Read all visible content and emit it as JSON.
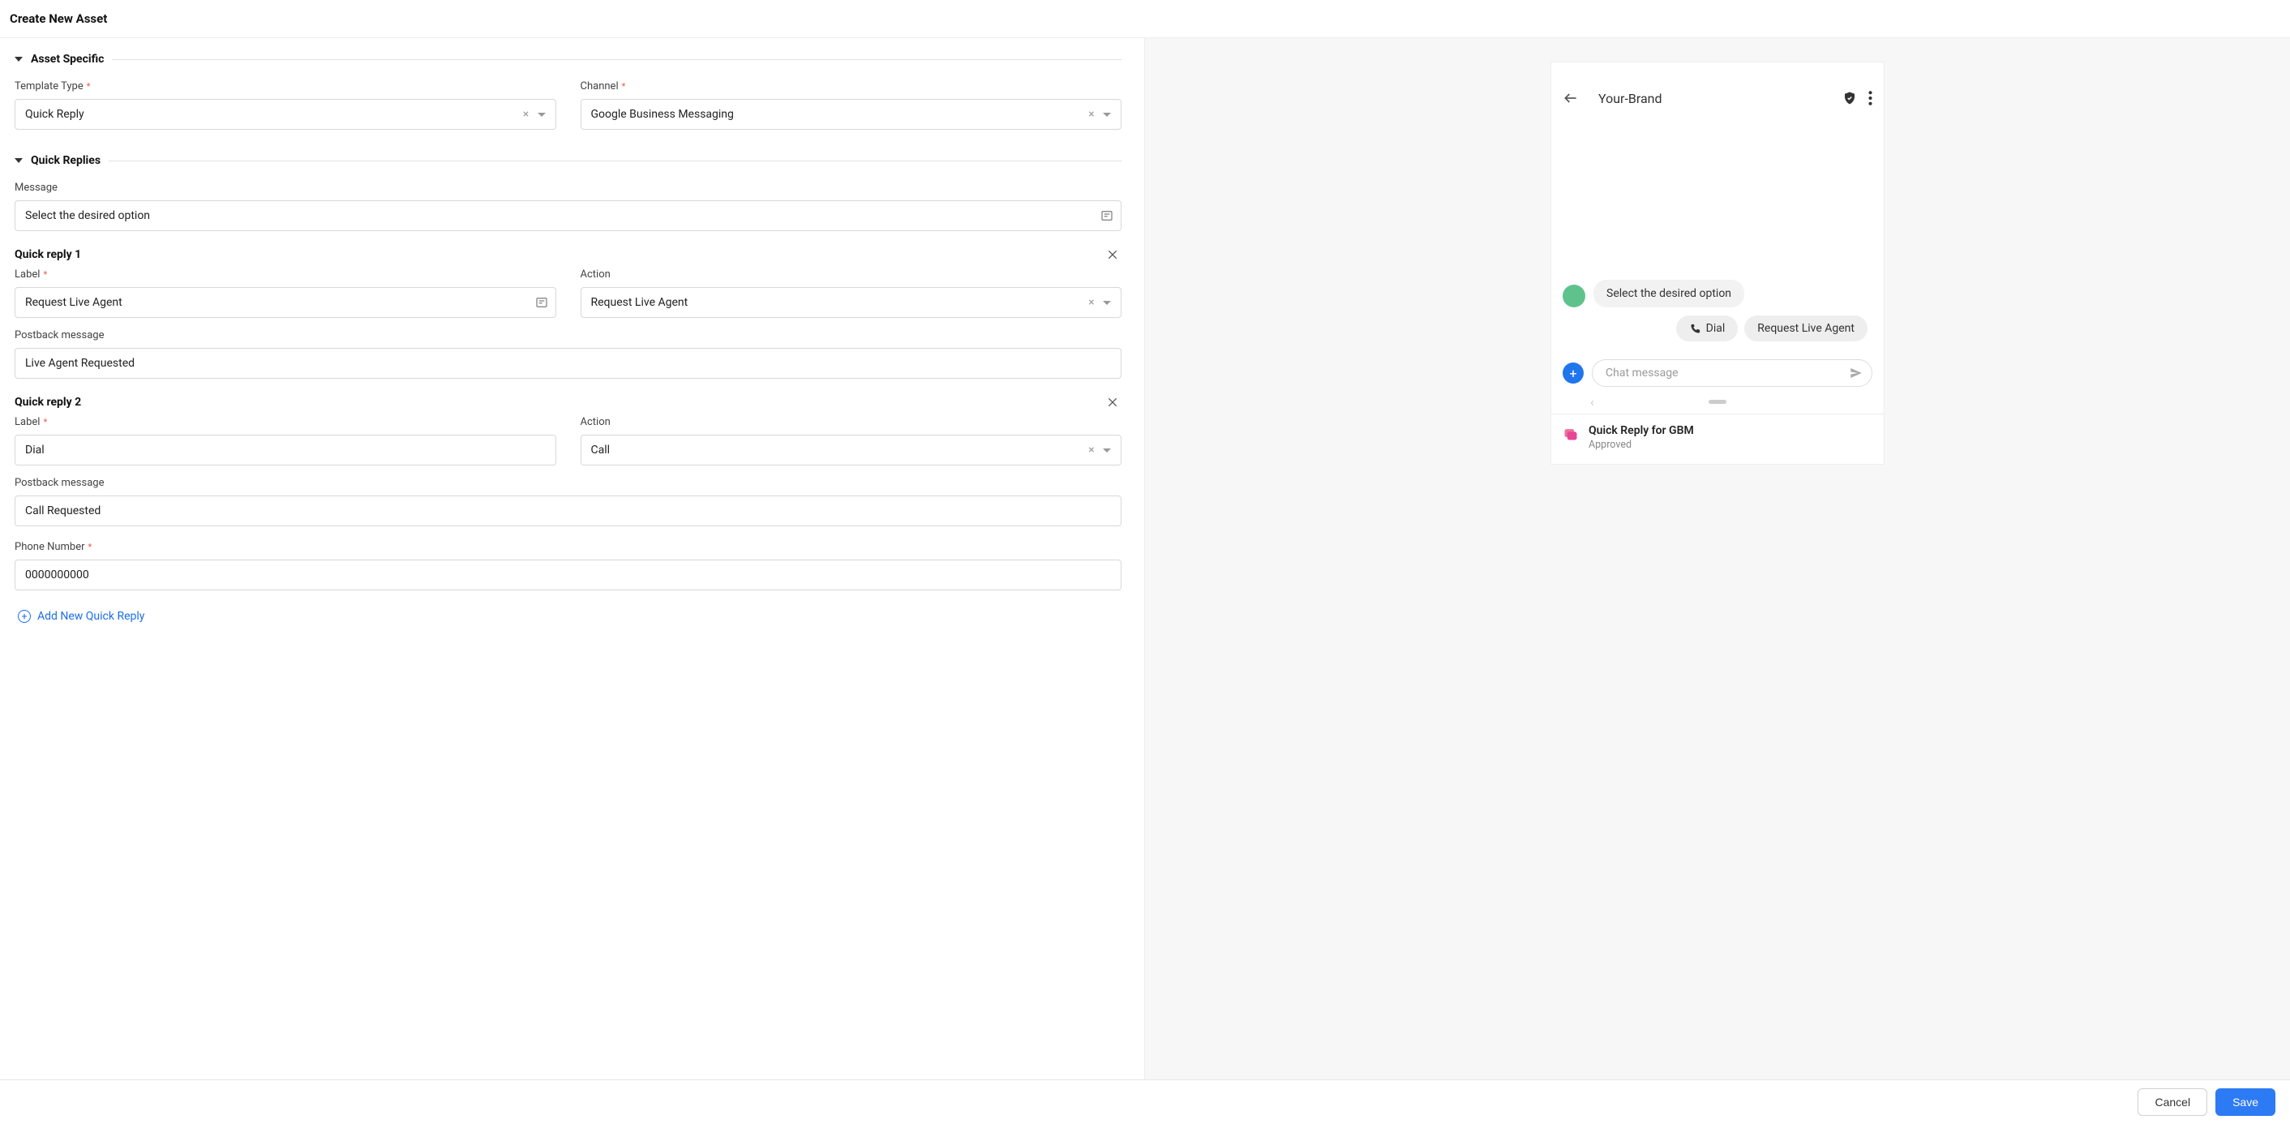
{
  "header": {
    "title": "Create New Asset"
  },
  "sections": {
    "asset_specific": {
      "title": "Asset Specific",
      "template_type": {
        "label": "Template Type",
        "value": "Quick Reply"
      },
      "channel": {
        "label": "Channel",
        "value": "Google Business Messaging"
      }
    },
    "quick_replies": {
      "title": "Quick Replies",
      "message_label": "Message",
      "message_value": "Select the desired option",
      "items": [
        {
          "title": "Quick reply 1",
          "label_label": "Label",
          "label_value": "Request Live Agent",
          "action_label": "Action",
          "action_value": "Request Live Agent",
          "postback_label": "Postback message",
          "postback_value": "Live Agent Requested"
        },
        {
          "title": "Quick reply 2",
          "label_label": "Label",
          "label_value": "Dial",
          "action_label": "Action",
          "action_value": "Call",
          "postback_label": "Postback message",
          "postback_value": "Call Requested",
          "phone_label": "Phone Number",
          "phone_value": "0000000000"
        }
      ],
      "add_link": "Add New Quick Reply"
    }
  },
  "preview": {
    "brand": "Your-Brand",
    "bubble_text": "Select the desired option",
    "chips": {
      "dial": "Dial",
      "live_agent": "Request Live Agent"
    },
    "compose_placeholder": "Chat message",
    "footer_title": "Quick Reply for GBM",
    "footer_status": "Approved"
  },
  "footer": {
    "cancel": "Cancel",
    "save": "Save"
  }
}
